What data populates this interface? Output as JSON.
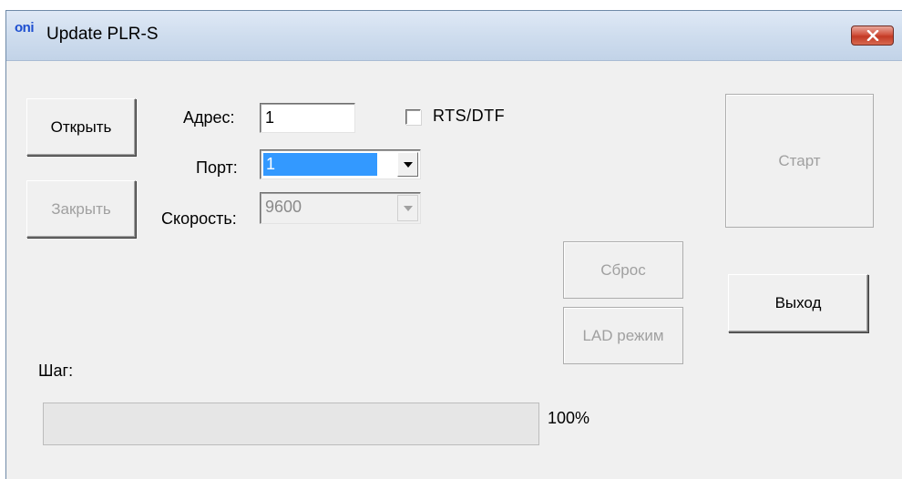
{
  "window": {
    "logo_text": "oni",
    "title": "Update PLR-S"
  },
  "buttons": {
    "open": "Открыть",
    "close": "Закрыть",
    "start": "Старт",
    "reset": "Сброс",
    "lad_mode": "LAD режим",
    "exit": "Выход"
  },
  "form": {
    "address_label": "Адрес:",
    "address_value": "1",
    "rts_dtf_label": "RTS/DTF",
    "rts_dtf_checked": false,
    "port_label": "Порт:",
    "port_value": "1",
    "speed_label": "Скорость:",
    "speed_value": "9600"
  },
  "progress": {
    "step_label": "Шаг:",
    "percent_text": "100%",
    "value": 0
  },
  "colors": {
    "selection": "#3399ff",
    "disabled_text": "#a0a0a0",
    "logo": "#1e4fd0",
    "close_button": "#c33a25"
  },
  "icons": {
    "close": "close-icon",
    "dropdown": "chevron-down-icon"
  }
}
